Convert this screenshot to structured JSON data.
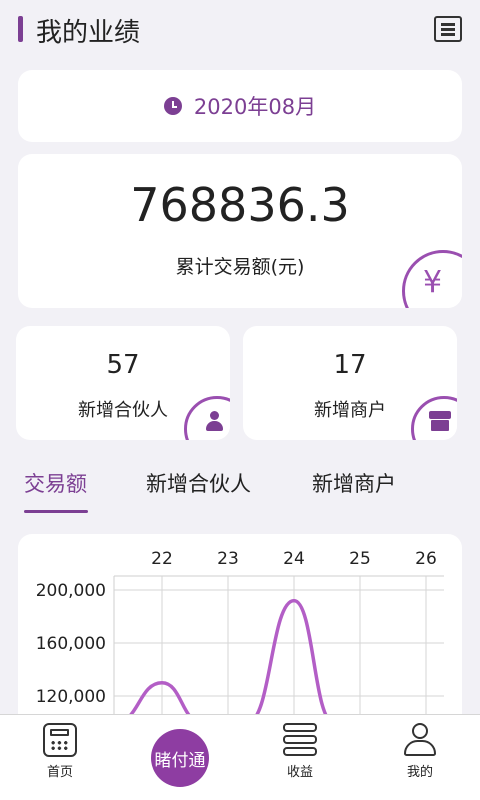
{
  "header": {
    "title": "我的业绩",
    "menu_icon": "list-menu-icon"
  },
  "date_card": {
    "date": "2020年08月",
    "icon": "clock-icon"
  },
  "summary": {
    "total_value": "768836.3",
    "total_label": "累计交易额(元)",
    "currency_symbol": "¥"
  },
  "stats": [
    {
      "value": "57",
      "label": "新增合伙人",
      "icon": "person-icon"
    },
    {
      "value": "17",
      "label": "新增商户",
      "icon": "shop-icon"
    }
  ],
  "tabs": [
    {
      "label": "交易额",
      "active": true
    },
    {
      "label": "新增合伙人",
      "active": false
    },
    {
      "label": "新增商户",
      "active": false
    }
  ],
  "chart_data": {
    "type": "line",
    "x_ticks": [
      "22",
      "23",
      "24",
      "25",
      "26"
    ],
    "y_ticks": [
      "200,000",
      "160,000",
      "120,000"
    ],
    "series": [
      {
        "color": "#b35ec6",
        "x": [
          21.3,
          22,
          22.6,
          23.3,
          24,
          24.6
        ],
        "y": [
          100000,
          130000,
          100000,
          100000,
          192000,
          100000
        ]
      }
    ]
  },
  "bottom_nav": {
    "items": [
      {
        "label": "首页",
        "icon": "calculator-icon"
      },
      {
        "label": "睹付通",
        "icon": "brand-center-button"
      },
      {
        "label": "收益",
        "icon": "stack-icon"
      },
      {
        "label": "我的",
        "icon": "user-icon"
      }
    ]
  },
  "colors": {
    "accent": "#7c3f93",
    "chart_line": "#b35ec6",
    "background": "#f2f1f6"
  }
}
